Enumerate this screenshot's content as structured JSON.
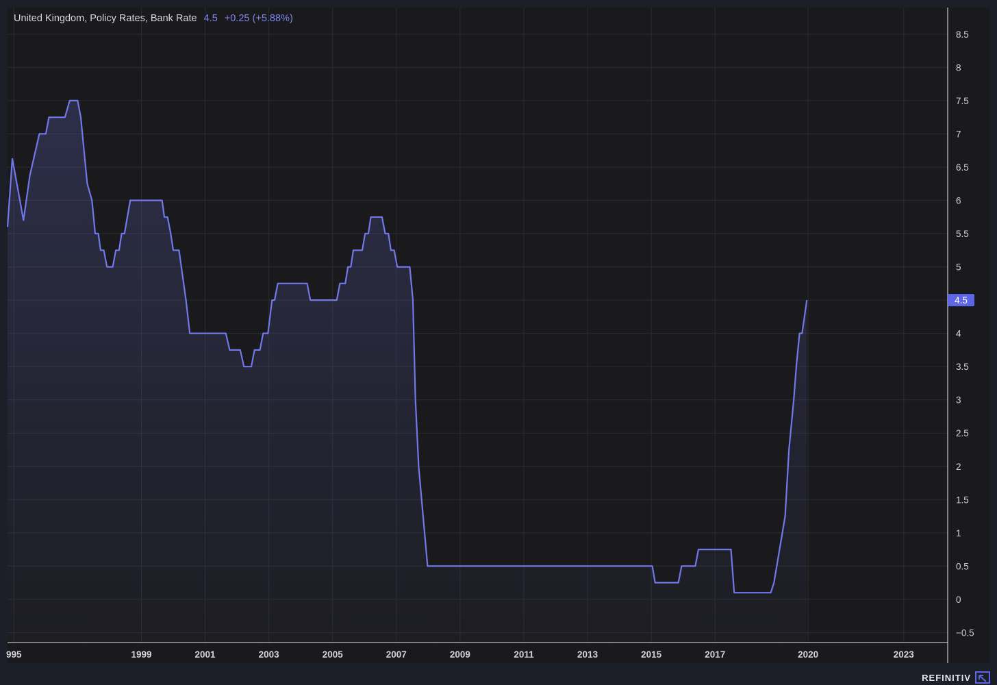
{
  "header": {
    "title": "United Kingdom, Policy Rates, Bank Rate",
    "last_value": "4.5",
    "change": "+0.25 (+5.88%)"
  },
  "brand": {
    "name": "REFINITIV",
    "icon": "refinitiv-logo-icon"
  },
  "colors": {
    "background": "#1a1a1c",
    "outer": "#1c1f28",
    "line": "#7078ea",
    "grid": "#2a2c31",
    "axis_text": "#d0d3da",
    "last_value_badge": "#5d67e6"
  },
  "chart_data": {
    "type": "area",
    "title": "United Kingdom, Policy Rates, Bank Rate",
    "xlabel": "",
    "ylabel": "",
    "ylim": [
      -0.65,
      8.9
    ],
    "xlim": [
      1994.8,
      2024.3
    ],
    "grid": true,
    "y_axis_side": "right",
    "y_ticks": [
      "8.5",
      "8",
      "7.5",
      "7",
      "6.5",
      "6",
      "5.5",
      "5",
      "4.5",
      "4",
      "3.5",
      "3",
      "2.5",
      "2",
      "1.5",
      "1",
      "0.5",
      "0",
      "−0.5"
    ],
    "x_ticks": [
      {
        "label": "995",
        "x": 1995.0
      },
      {
        "label": "1999",
        "x": 1999.0
      },
      {
        "label": "2001",
        "x": 2001.0
      },
      {
        "label": "2003",
        "x": 2003.0
      },
      {
        "label": "2005",
        "x": 2005.0
      },
      {
        "label": "2007",
        "x": 2007.0
      },
      {
        "label": "2009",
        "x": 2009.0
      },
      {
        "label": "2011",
        "x": 2011.0
      },
      {
        "label": "2013",
        "x": 2013.0
      },
      {
        "label": "2015",
        "x": 2015.0
      },
      {
        "label": "2017",
        "x": 2017.0
      },
      {
        "label": "2020",
        "x": 2019.92
      },
      {
        "label": "2023",
        "x": 2022.92
      }
    ],
    "last_value_label": "4.5",
    "series": [
      {
        "values": [
          [
            1994.8,
            5.6
          ],
          [
            1994.95,
            6.625
          ],
          [
            1995.15,
            6.1
          ],
          [
            1995.3,
            5.7
          ],
          [
            1995.5,
            6.375
          ],
          [
            1995.8,
            7.0
          ],
          [
            1996.0,
            7.0
          ],
          [
            1996.1,
            7.25
          ],
          [
            1996.6,
            7.25
          ],
          [
            1996.75,
            7.5
          ],
          [
            1997.0,
            7.5
          ],
          [
            1997.1,
            7.25
          ],
          [
            1997.3,
            6.25
          ],
          [
            1997.45,
            6.0
          ],
          [
            1997.55,
            5.5
          ],
          [
            1997.65,
            5.5
          ],
          [
            1997.72,
            5.25
          ],
          [
            1997.82,
            5.25
          ],
          [
            1997.92,
            5.0
          ],
          [
            1998.1,
            5.0
          ],
          [
            1998.2,
            5.25
          ],
          [
            1998.3,
            5.25
          ],
          [
            1998.38,
            5.5
          ],
          [
            1998.47,
            5.5
          ],
          [
            1998.65,
            6.0
          ],
          [
            1999.65,
            6.0
          ],
          [
            1999.72,
            5.75
          ],
          [
            1999.82,
            5.75
          ],
          [
            1999.92,
            5.5
          ],
          [
            2000.0,
            5.25
          ],
          [
            2000.18,
            5.25
          ],
          [
            2000.4,
            4.5
          ],
          [
            2000.52,
            4.0
          ],
          [
            2001.65,
            4.0
          ],
          [
            2001.77,
            3.75
          ],
          [
            2002.1,
            3.75
          ],
          [
            2002.22,
            3.5
          ],
          [
            2002.45,
            3.5
          ],
          [
            2002.55,
            3.75
          ],
          [
            2002.72,
            3.75
          ],
          [
            2002.82,
            4.0
          ],
          [
            2002.97,
            4.0
          ],
          [
            2003.1,
            4.5
          ],
          [
            2003.18,
            4.5
          ],
          [
            2003.28,
            4.75
          ],
          [
            2004.2,
            4.75
          ],
          [
            2004.3,
            4.5
          ],
          [
            2005.13,
            4.5
          ],
          [
            2005.23,
            4.75
          ],
          [
            2005.4,
            4.75
          ],
          [
            2005.48,
            5.0
          ],
          [
            2005.57,
            5.0
          ],
          [
            2005.65,
            5.25
          ],
          [
            2005.93,
            5.25
          ],
          [
            2006.02,
            5.5
          ],
          [
            2006.12,
            5.5
          ],
          [
            2006.2,
            5.75
          ],
          [
            2006.55,
            5.75
          ],
          [
            2006.65,
            5.5
          ],
          [
            2006.75,
            5.5
          ],
          [
            2006.83,
            5.25
          ],
          [
            2006.93,
            5.25
          ],
          [
            2007.03,
            5.0
          ],
          [
            2007.42,
            5.0
          ],
          [
            2007.52,
            4.5
          ],
          [
            2007.6,
            3.0
          ],
          [
            2007.7,
            2.0
          ],
          [
            2007.98,
            0.5
          ],
          [
            2015.03,
            0.5
          ],
          [
            2015.12,
            0.25
          ],
          [
            2015.85,
            0.25
          ],
          [
            2015.95,
            0.5
          ],
          [
            2016.38,
            0.5
          ],
          [
            2016.48,
            0.75
          ],
          [
            2017.5,
            0.75
          ],
          [
            2017.6,
            0.1
          ],
          [
            2018.75,
            0.1
          ],
          [
            2018.85,
            0.25
          ],
          [
            2019.2,
            1.25
          ],
          [
            2019.32,
            2.25
          ],
          [
            2019.47,
            3.0
          ],
          [
            2019.55,
            3.5
          ],
          [
            2019.65,
            4.0
          ],
          [
            2019.73,
            4.0
          ],
          [
            2019.88,
            4.5
          ]
        ]
      }
    ]
  }
}
